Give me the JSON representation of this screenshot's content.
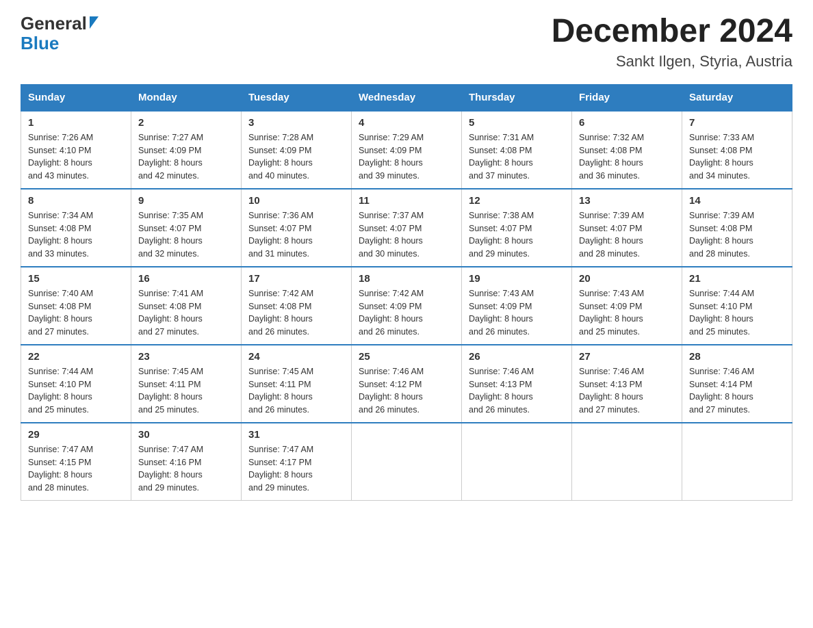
{
  "header": {
    "logo_line1": "General",
    "logo_line2": "Blue",
    "title": "December 2024",
    "subtitle": "Sankt Ilgen, Styria, Austria"
  },
  "days_of_week": [
    "Sunday",
    "Monday",
    "Tuesday",
    "Wednesday",
    "Thursday",
    "Friday",
    "Saturday"
  ],
  "weeks": [
    [
      {
        "num": "1",
        "sunrise": "7:26 AM",
        "sunset": "4:10 PM",
        "daylight": "8 hours and 43 minutes."
      },
      {
        "num": "2",
        "sunrise": "7:27 AM",
        "sunset": "4:09 PM",
        "daylight": "8 hours and 42 minutes."
      },
      {
        "num": "3",
        "sunrise": "7:28 AM",
        "sunset": "4:09 PM",
        "daylight": "8 hours and 40 minutes."
      },
      {
        "num": "4",
        "sunrise": "7:29 AM",
        "sunset": "4:09 PM",
        "daylight": "8 hours and 39 minutes."
      },
      {
        "num": "5",
        "sunrise": "7:31 AM",
        "sunset": "4:08 PM",
        "daylight": "8 hours and 37 minutes."
      },
      {
        "num": "6",
        "sunrise": "7:32 AM",
        "sunset": "4:08 PM",
        "daylight": "8 hours and 36 minutes."
      },
      {
        "num": "7",
        "sunrise": "7:33 AM",
        "sunset": "4:08 PM",
        "daylight": "8 hours and 34 minutes."
      }
    ],
    [
      {
        "num": "8",
        "sunrise": "7:34 AM",
        "sunset": "4:08 PM",
        "daylight": "8 hours and 33 minutes."
      },
      {
        "num": "9",
        "sunrise": "7:35 AM",
        "sunset": "4:07 PM",
        "daylight": "8 hours and 32 minutes."
      },
      {
        "num": "10",
        "sunrise": "7:36 AM",
        "sunset": "4:07 PM",
        "daylight": "8 hours and 31 minutes."
      },
      {
        "num": "11",
        "sunrise": "7:37 AM",
        "sunset": "4:07 PM",
        "daylight": "8 hours and 30 minutes."
      },
      {
        "num": "12",
        "sunrise": "7:38 AM",
        "sunset": "4:07 PM",
        "daylight": "8 hours and 29 minutes."
      },
      {
        "num": "13",
        "sunrise": "7:39 AM",
        "sunset": "4:07 PM",
        "daylight": "8 hours and 28 minutes."
      },
      {
        "num": "14",
        "sunrise": "7:39 AM",
        "sunset": "4:08 PM",
        "daylight": "8 hours and 28 minutes."
      }
    ],
    [
      {
        "num": "15",
        "sunrise": "7:40 AM",
        "sunset": "4:08 PM",
        "daylight": "8 hours and 27 minutes."
      },
      {
        "num": "16",
        "sunrise": "7:41 AM",
        "sunset": "4:08 PM",
        "daylight": "8 hours and 27 minutes."
      },
      {
        "num": "17",
        "sunrise": "7:42 AM",
        "sunset": "4:08 PM",
        "daylight": "8 hours and 26 minutes."
      },
      {
        "num": "18",
        "sunrise": "7:42 AM",
        "sunset": "4:09 PM",
        "daylight": "8 hours and 26 minutes."
      },
      {
        "num": "19",
        "sunrise": "7:43 AM",
        "sunset": "4:09 PM",
        "daylight": "8 hours and 26 minutes."
      },
      {
        "num": "20",
        "sunrise": "7:43 AM",
        "sunset": "4:09 PM",
        "daylight": "8 hours and 25 minutes."
      },
      {
        "num": "21",
        "sunrise": "7:44 AM",
        "sunset": "4:10 PM",
        "daylight": "8 hours and 25 minutes."
      }
    ],
    [
      {
        "num": "22",
        "sunrise": "7:44 AM",
        "sunset": "4:10 PM",
        "daylight": "8 hours and 25 minutes."
      },
      {
        "num": "23",
        "sunrise": "7:45 AM",
        "sunset": "4:11 PM",
        "daylight": "8 hours and 25 minutes."
      },
      {
        "num": "24",
        "sunrise": "7:45 AM",
        "sunset": "4:11 PM",
        "daylight": "8 hours and 26 minutes."
      },
      {
        "num": "25",
        "sunrise": "7:46 AM",
        "sunset": "4:12 PM",
        "daylight": "8 hours and 26 minutes."
      },
      {
        "num": "26",
        "sunrise": "7:46 AM",
        "sunset": "4:13 PM",
        "daylight": "8 hours and 26 minutes."
      },
      {
        "num": "27",
        "sunrise": "7:46 AM",
        "sunset": "4:13 PM",
        "daylight": "8 hours and 27 minutes."
      },
      {
        "num": "28",
        "sunrise": "7:46 AM",
        "sunset": "4:14 PM",
        "daylight": "8 hours and 27 minutes."
      }
    ],
    [
      {
        "num": "29",
        "sunrise": "7:47 AM",
        "sunset": "4:15 PM",
        "daylight": "8 hours and 28 minutes."
      },
      {
        "num": "30",
        "sunrise": "7:47 AM",
        "sunset": "4:16 PM",
        "daylight": "8 hours and 29 minutes."
      },
      {
        "num": "31",
        "sunrise": "7:47 AM",
        "sunset": "4:17 PM",
        "daylight": "8 hours and 29 minutes."
      },
      null,
      null,
      null,
      null
    ]
  ],
  "labels": {
    "sunrise": "Sunrise:",
    "sunset": "Sunset:",
    "daylight": "Daylight:"
  }
}
